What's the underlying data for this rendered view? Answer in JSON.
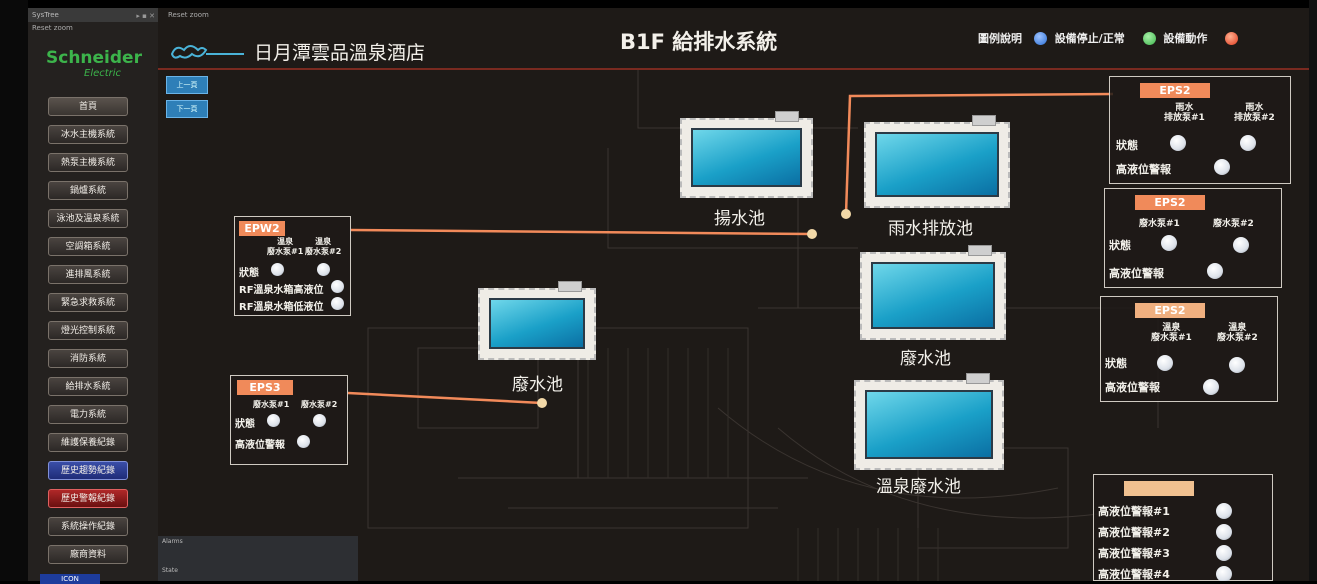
{
  "left_panel": {
    "title": "SysTree",
    "subtitle": "Reset zoom",
    "logo_main": "Schneider",
    "logo_sub": "Electric",
    "nav": [
      "首頁",
      "冰水主機系統",
      "熱泵主機系統",
      "鍋爐系統",
      "泳池及溫泉系統",
      "空調箱系統",
      "進排風系統",
      "緊急求救系統",
      "燈光控制系統",
      "消防系統",
      "給排水系統",
      "電力系統",
      "維護保養紀錄",
      "歷史趨勢紀錄",
      "歷史警報紀錄",
      "系統操作紀錄",
      "廠商資料"
    ]
  },
  "main": {
    "zoom_title": "Reset zoom",
    "hotel_name": "日月潭雲品溫泉酒店",
    "page_title": "B1F 給排水系統",
    "legend": {
      "label": "圖例說明",
      "item1": "設備停止/正常",
      "item2": "設備動作",
      "color1": "#2b6fd6",
      "color2": "#3cb44b",
      "color3": "#e03a1e"
    },
    "page_buttons": [
      "上一頁",
      "下一頁"
    ],
    "alarms_title": "Alarms",
    "state_label": "State"
  },
  "tanks": [
    "揚水池",
    "雨水排放池",
    "廢水池",
    "廢水池",
    "溫泉廢水池"
  ],
  "epw2": {
    "tag": "EPW2",
    "pump1": "溫泉\n廢水泵#1",
    "pump2": "溫泉\n廢水泵#2",
    "status": "狀態",
    "alarm_high": "RF溫泉水箱高液位",
    "alarm_low": "RF溫泉水箱低液位"
  },
  "eps3": {
    "tag": "EPS3",
    "pump1": "廢水泵#1",
    "pump2": "廢水泵#2",
    "status": "狀態",
    "alarm": "高液位警報"
  },
  "eps2a": {
    "tag": "EPS2",
    "pump1": "雨水\n排放泵#1",
    "pump2": "雨水\n排放泵#2",
    "status": "狀態",
    "alarm": "高液位警報"
  },
  "eps2b": {
    "tag": "EPS2",
    "pump1": "廢水泵#1",
    "pump2": "廢水泵#2",
    "status": "狀態",
    "alarm": "高液位警報"
  },
  "eps_c": {
    "tag": "EPS2",
    "pump1": "溫泉\n廢水泵#1",
    "pump2": "溫泉\n廢水泵#2",
    "status": "狀態",
    "alarm": "高液位警報"
  },
  "alarm_list": [
    "高液位警報#1",
    "高液位警報#2",
    "高液位警報#3",
    "高液位警報#4"
  ]
}
